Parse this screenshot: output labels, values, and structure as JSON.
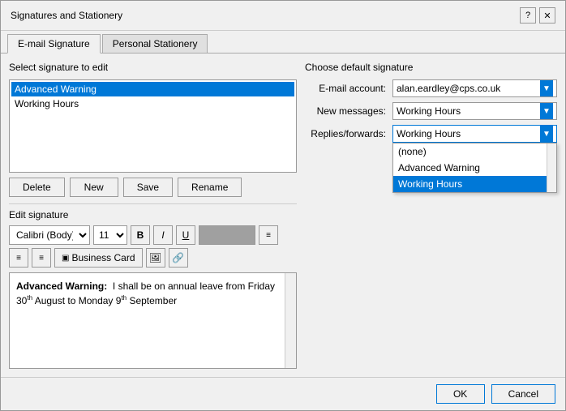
{
  "dialog": {
    "title": "Signatures and Stationery",
    "help_btn": "?",
    "close_btn": "✕"
  },
  "tabs": [
    {
      "id": "email-sig",
      "label": "E-mail Signature",
      "active": true
    },
    {
      "id": "personal-stationery",
      "label": "Personal Stationery",
      "active": false
    }
  ],
  "left": {
    "select_label": "Select signature to edit",
    "signatures": [
      {
        "label": "Advanced Warning",
        "selected": true
      },
      {
        "label": "Working Hours",
        "selected": false
      }
    ],
    "buttons": {
      "delete": "Delete",
      "new": "New",
      "save": "Save",
      "rename": "Rename"
    },
    "edit_label": "Edit signature",
    "toolbar": {
      "font": "Calibri (Body)",
      "size": "11",
      "bold": "B",
      "italic": "I",
      "underline": "U",
      "align_left": "≡",
      "align_center": "≡",
      "align_right": "≡",
      "business_card": "Business Card"
    },
    "editor_content": "Advanced Warning:  I shall be on annual leave from Friday 30th August to Monday 9th September"
  },
  "right": {
    "choose_label": "Choose default signature",
    "email_account_label": "E-mail account:",
    "email_account_value": "alan.eardley@cps.co.uk",
    "new_messages_label": "New messages:",
    "new_messages_value": "Working Hours",
    "replies_label": "Replies/forwards:",
    "replies_value": "Working Hours",
    "dropdown_options": [
      {
        "label": "(none)",
        "selected": false
      },
      {
        "label": "Advanced Warning",
        "selected": false
      },
      {
        "label": "Working Hours",
        "selected": true
      }
    ]
  },
  "footer": {
    "ok": "OK",
    "cancel": "Cancel"
  }
}
